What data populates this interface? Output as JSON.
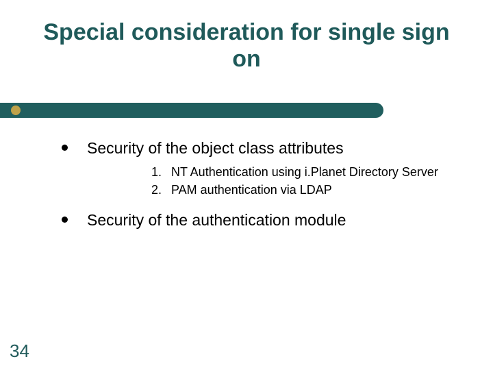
{
  "title": "Special consideration for single sign on",
  "bullets": [
    {
      "text": "Security of the object class attributes",
      "subs": [
        {
          "num": "1.",
          "text": "NT Authentication using i.Planet Directory Server"
        },
        {
          "num": "2.",
          "text": "PAM authentication via LDAP"
        }
      ]
    },
    {
      "text": "Security of the authentication module",
      "subs": []
    }
  ],
  "page_number": "34"
}
